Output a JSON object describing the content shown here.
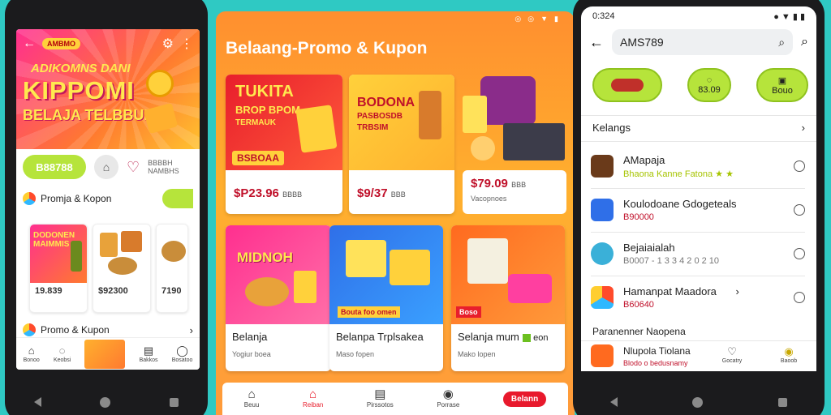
{
  "left_phone": {
    "banner": {
      "logo": "AMBMO",
      "line1": "ADIKOMNS DANI",
      "line2": "KIPPOMI",
      "line3": "BELAJA TELBBUK"
    },
    "code_button": "B88788",
    "side_text": "BBBBH\nNAMBHS",
    "section1_title": "Promja & Kopon",
    "product_cards": [
      {
        "title": "DODONEN MAIMMIS",
        "price": "19.839"
      },
      {
        "title": "",
        "price": "$92300"
      },
      {
        "title": "",
        "price": "7190"
      }
    ],
    "section2_title": "Promo & Kupon",
    "tabs": [
      {
        "icon": "home-icon",
        "label": "Bonoo"
      },
      {
        "icon": "chat-icon",
        "label": "Keobsi"
      },
      {
        "icon": "coupon-icon",
        "label": ""
      },
      {
        "icon": "notes-icon",
        "label": "Bakkos"
      },
      {
        "icon": "user-icon",
        "label": "Bosatoo"
      }
    ]
  },
  "center": {
    "title": "Belaang-Promo & Kupon",
    "cards": [
      {
        "img_line1": "TUKITA",
        "img_line2": "BROP BPOM",
        "img_line3": "TERMAUK",
        "img_badge": "BSBOAA",
        "price": "$P23.96",
        "price_suffix": "BBBB",
        "sub": ""
      },
      {
        "img_line1": "BODONA",
        "img_line2": "PASBOSDB",
        "img_line3": "TRBSIM",
        "img_badge": "",
        "price": "$9/37",
        "price_suffix": "BBB",
        "sub": ""
      },
      {
        "img_line1": "",
        "img_line2": "",
        "img_line3": "",
        "img_badge": "",
        "price": "$79.09",
        "price_suffix": "BBB",
        "sub": "Vacopnoes"
      },
      {
        "img_line1": "MIDNOH",
        "img_line2": "",
        "img_line3": "",
        "img_badge": "",
        "label": "Belanja",
        "sub": "Yogiur boea"
      },
      {
        "img_line1": "",
        "img_line2": "",
        "img_line3": "",
        "img_badge": "Bouta foo omen",
        "label": "Belanpa Trplsakea",
        "sub": "Maso fopen"
      },
      {
        "img_line1": "",
        "img_line2": "",
        "img_line3": "",
        "img_badge": "Boso",
        "label": "Selanja mum",
        "label_suffix": "eon",
        "sub": "Mako lopen"
      }
    ],
    "tabs": [
      {
        "icon": "home-icon",
        "label": "Beuu"
      },
      {
        "icon": "shop-icon",
        "label": "Reiban"
      },
      {
        "icon": "list-icon",
        "label": "Pirssotos"
      },
      {
        "icon": "chat-icon",
        "label": "Porrase"
      }
    ],
    "promo_pill": "Belann",
    "accent": "#e8192c"
  },
  "right_phone": {
    "time": "0:324",
    "search_value": "AMS789",
    "pills": [
      {
        "label": ""
      },
      {
        "label": "83.09"
      },
      {
        "label": "Bouo"
      }
    ],
    "section_title": "Kelangs",
    "items": [
      {
        "title": "AMapaja",
        "sub": "Bhaona Kanne Fatona ★ ★",
        "sub_color": "#a6c400"
      },
      {
        "title": "Koulodoane Gdogeteals",
        "sub": "B90000",
        "sub_color": "#c0102a"
      },
      {
        "title": "Bejaiaialah",
        "sub": "B0007 - 1 3 3 4 2 0 2 10",
        "sub_color": "#777777"
      },
      {
        "title": "Hamanpat Maadora",
        "sub": "B60640",
        "sub_color": "#c0102a"
      }
    ],
    "footer_title": "Paranenner Naopena",
    "last_item": {
      "title": "Nlupola Tiolana",
      "sub": "Blodo o bedusnamy"
    },
    "tabs": [
      {
        "icon": "heart-icon",
        "label": "Gocatry"
      },
      {
        "icon": "user-icon",
        "label": "Baoob"
      }
    ]
  }
}
